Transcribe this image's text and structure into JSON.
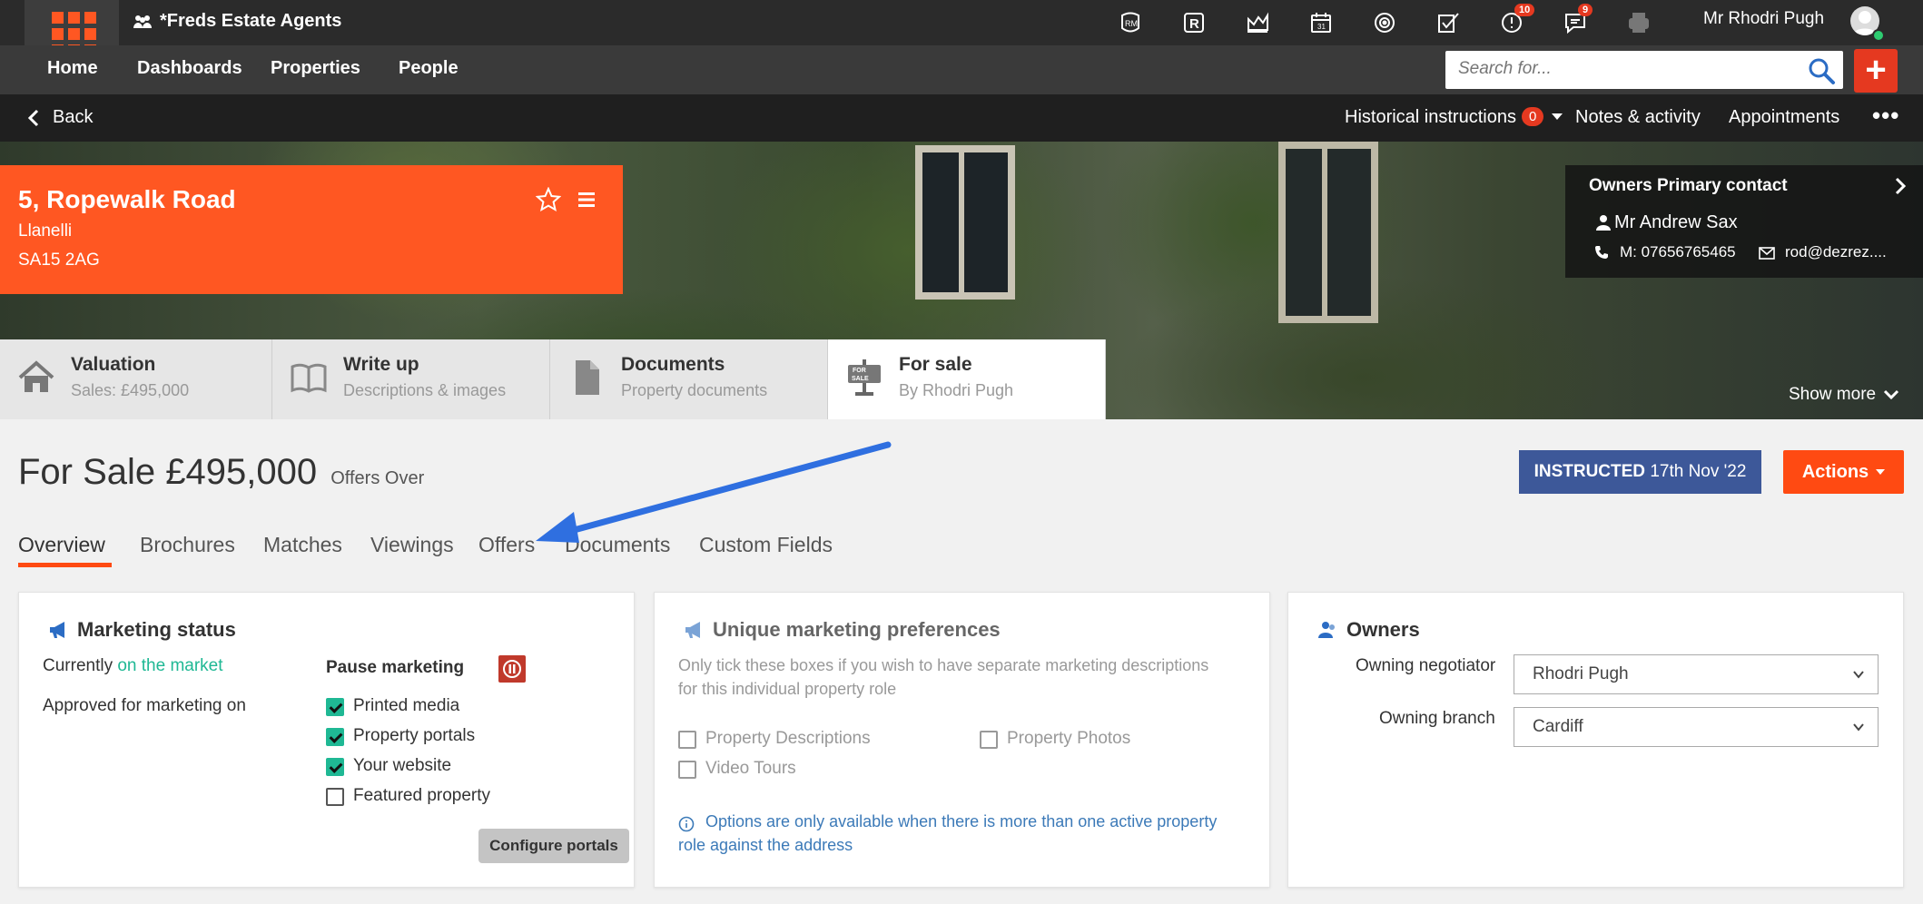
{
  "app": {
    "agency_name": "*Freds Estate Agents",
    "user_name": "Mr Rhodri Pugh",
    "notifications": {
      "alerts_count": "10",
      "messages_count": "9"
    }
  },
  "nav": {
    "items": [
      {
        "label": "Home"
      },
      {
        "label": "Dashboards"
      },
      {
        "label": "Properties"
      },
      {
        "label": "People"
      }
    ],
    "search_placeholder": "Search for...",
    "add_label": "+"
  },
  "subbar": {
    "back_label": "Back",
    "historical_label": "Historical instructions",
    "historical_count": "0",
    "notes_label": "Notes & activity",
    "appointments_label": "Appointments",
    "more_label": "•••"
  },
  "property": {
    "address_line1": "5, Ropewalk Road",
    "town": "Llanelli",
    "postcode": "SA15 2AG"
  },
  "primary_contact": {
    "title": "Owners Primary contact",
    "name": "Mr Andrew Sax",
    "mobile": "M: 07656765465",
    "email": "rod@dezrez...."
  },
  "show_more_label": "Show more",
  "role_tabs": [
    {
      "title": "Valuation",
      "subtitle": "Sales: £495,000"
    },
    {
      "title": "Write up",
      "subtitle": "Descriptions & images"
    },
    {
      "title": "Documents",
      "subtitle": "Property documents"
    },
    {
      "title": "For sale",
      "subtitle": "By Rhodri Pugh"
    }
  ],
  "listing": {
    "price_text": "For Sale £495,000",
    "price_qualifier": "Offers Over",
    "instructed_label": "INSTRUCTED",
    "instructed_date": "17th Nov '22",
    "actions_label": "Actions"
  },
  "sub_tabs": [
    {
      "label": "Overview"
    },
    {
      "label": "Brochures"
    },
    {
      "label": "Matches"
    },
    {
      "label": "Viewings"
    },
    {
      "label": "Offers"
    },
    {
      "label": "Documents"
    },
    {
      "label": "Custom Fields"
    }
  ],
  "marketing_status": {
    "title": "Marketing status",
    "currently_label": "Currently",
    "currently_value": "on the market",
    "approved_label": "Approved for marketing on",
    "pause_label": "Pause marketing",
    "channels": [
      {
        "label": "Printed media",
        "checked": true
      },
      {
        "label": "Property portals",
        "checked": true
      },
      {
        "label": "Your website",
        "checked": true
      },
      {
        "label": "Featured property",
        "checked": false
      }
    ],
    "configure_label": "Configure portals"
  },
  "unique_prefs": {
    "title": "Unique marketing preferences",
    "description_line1": "Only tick these boxes if you wish to have separate marketing descriptions",
    "description_line2": "for this individual property role",
    "options": [
      {
        "label": "Property Descriptions"
      },
      {
        "label": "Property Photos"
      },
      {
        "label": "Video Tours"
      }
    ],
    "info_line1": "Options are only available when there is more than one active property",
    "info_line2": "role against the address"
  },
  "owners": {
    "title": "Owners",
    "negotiator_label": "Owning negotiator",
    "negotiator_value": "Rhodri Pugh",
    "branch_label": "Owning branch",
    "branch_value": "Cardiff"
  },
  "colors": {
    "accent_orange": "#ff5722",
    "instructed_blue": "#3d5899",
    "market_green": "#1fb894",
    "annotation_arrow": "#2f6fe0"
  }
}
